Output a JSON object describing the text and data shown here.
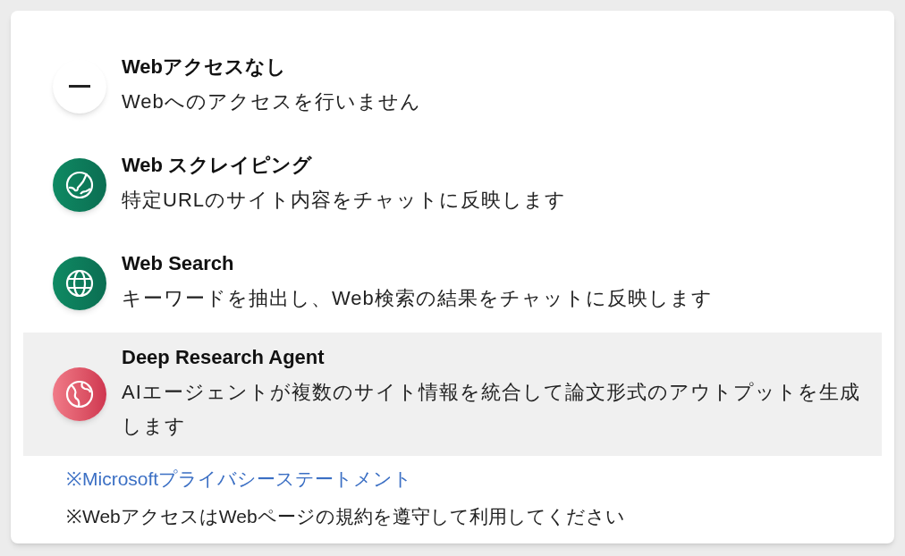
{
  "options": [
    {
      "kind": "none",
      "title": "Webアクセスなし",
      "description": "Webへのアクセスを行いません",
      "selected": false
    },
    {
      "kind": "scraping",
      "title": "Web スクレイピング",
      "description": "特定URLのサイト内容をチャットに反映します",
      "selected": false
    },
    {
      "kind": "search",
      "title": "Web Search",
      "description": "キーワードを抽出し、Web検索の結果をチャットに反映します",
      "selected": false
    },
    {
      "kind": "research",
      "title": "Deep Research Agent",
      "description": "AIエージェントが複数のサイト情報を統合して論文形式のアウトプットを生成します",
      "selected": true
    }
  ],
  "privacy_link": "※Microsoftプライバシーステートメント",
  "note": "※WebアクセスはWebページの規約を遵守して利用してください"
}
